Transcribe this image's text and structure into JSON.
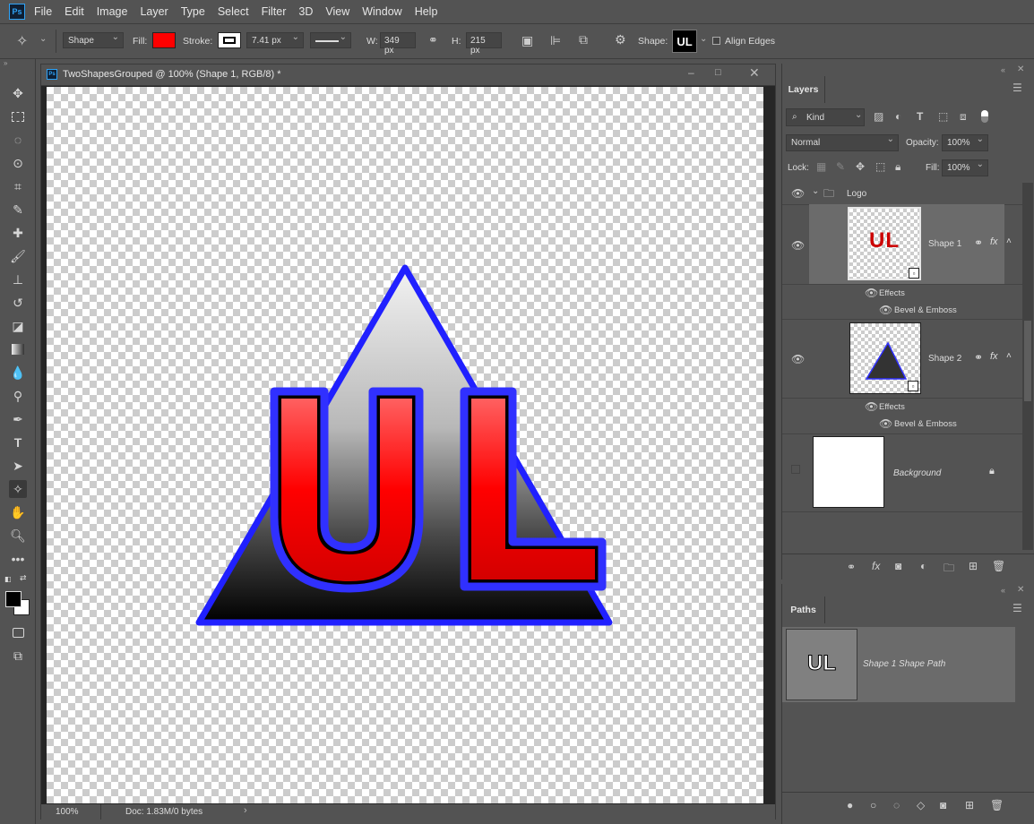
{
  "app": {
    "name": "Ps",
    "accent": "#2fa3f7"
  },
  "menu": [
    "File",
    "Edit",
    "Image",
    "Layer",
    "Type",
    "Select",
    "Filter",
    "3D",
    "View",
    "Window",
    "Help"
  ],
  "options": {
    "mode": "Shape",
    "fill_label": "Fill:",
    "fill_color": "#ff0000",
    "stroke_label": "Stroke:",
    "stroke_width": "7.41 px",
    "w_label": "W:",
    "w_value": "349 px",
    "h_label": "H:",
    "h_value": "215 px",
    "shape_label": "Shape:",
    "align_edges": "Align Edges",
    "shape_preview": "UL"
  },
  "document": {
    "tab_title": "TwoShapesGrouped @ 100% (Shape 1, RGB/8) *",
    "artwork_text": "UL",
    "zoom": "100%",
    "doc_info": "Doc: 1.83M/0 bytes"
  },
  "layers_panel": {
    "title": "Layers",
    "filter": "Kind",
    "blend_mode": "Normal",
    "opacity_label": "Opacity:",
    "opacity": "100%",
    "lock_label": "Lock:",
    "fill_label": "Fill:",
    "fill": "100%",
    "group_name": "Logo",
    "layers": [
      {
        "name": "Shape 1",
        "thumb_text": "UL",
        "effects": "Effects",
        "effect": "Bevel & Emboss"
      },
      {
        "name": "Shape 2",
        "effects": "Effects",
        "effect": "Bevel & Emboss"
      }
    ],
    "background": "Background"
  },
  "paths_panel": {
    "title": "Paths",
    "path_name": "Shape 1 Shape Path",
    "thumb_text": "UL"
  }
}
